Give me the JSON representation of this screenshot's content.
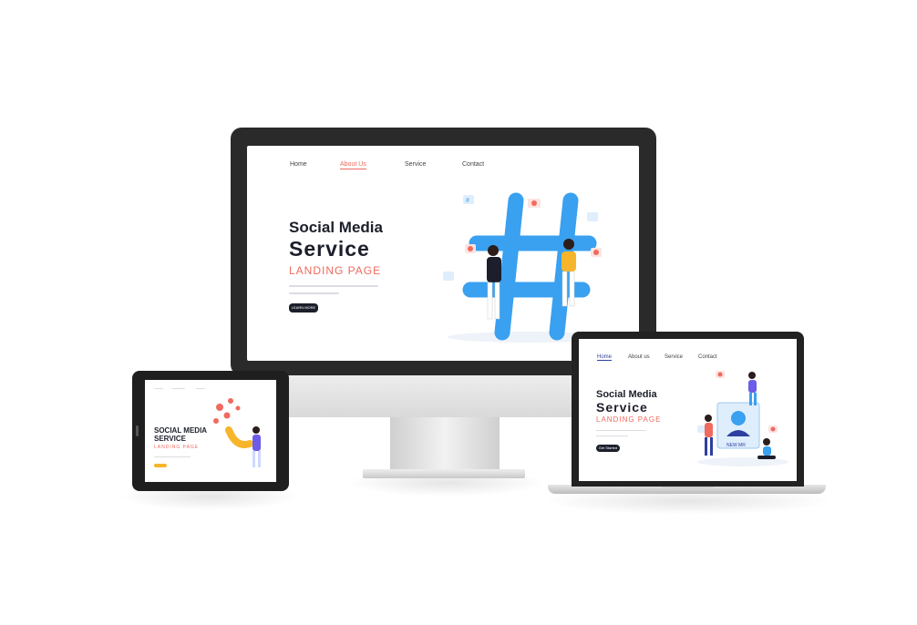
{
  "monitor": {
    "nav": [
      "Home",
      "About  Us",
      "Service",
      "Contact"
    ],
    "active_nav_index": 1,
    "title_line1": "Social Media",
    "title_line2": "Service",
    "subtitle": "LANDING PAGE",
    "button_label": "LEARN MORE"
  },
  "tablet": {
    "title_line1": "SOCIAL MEDIA",
    "title_line2": "SERVICE",
    "subtitle": "LANDING PAGE"
  },
  "laptop": {
    "nav": [
      "Home",
      "About us",
      "Service",
      "Contact"
    ],
    "active_nav_index": 0,
    "title_line1": "Social Media",
    "title_line2": "Service",
    "subtitle": "LANDING PAGE",
    "button_label": "Get Started",
    "card_caption": "NEW MR"
  },
  "colors": {
    "accent": "#f06a5e",
    "hashtag_blue": "#3aa0f0",
    "dark_text": "#1c1f2b",
    "device_frame": "#2a2a2a"
  },
  "icons": [
    "hashtag-icon",
    "heart-icon",
    "chat-bubble-icon",
    "magnet-icon",
    "user-card-icon"
  ]
}
